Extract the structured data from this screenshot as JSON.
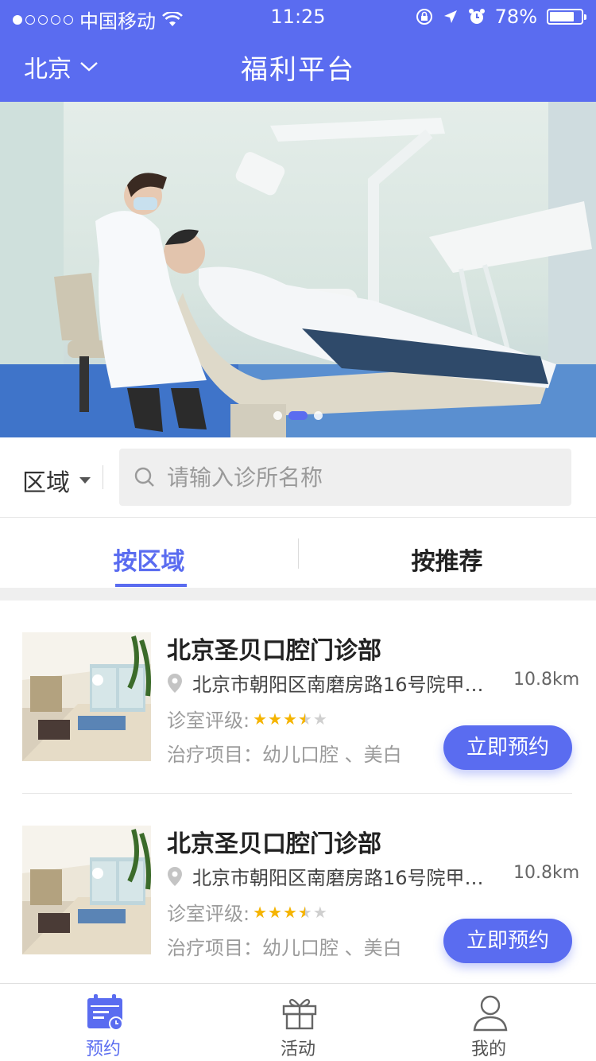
{
  "status_bar": {
    "carrier": "中国移动",
    "time": "11:25",
    "battery": "78%",
    "battery_level": 0.78
  },
  "header": {
    "city": "北京",
    "title": "福利平台"
  },
  "banner": {
    "active_slide": 2,
    "slide_count": 3
  },
  "search": {
    "region_label": "区域",
    "placeholder": "请输入诊所名称"
  },
  "tabs": [
    {
      "label": "按区域",
      "active": true
    },
    {
      "label": "按推荐",
      "active": false
    }
  ],
  "clinics": [
    {
      "name": "北京圣贝口腔门诊部",
      "address": "北京市朝阳区南磨房路16号院甲…",
      "distance": "10.8km",
      "rating_label": "诊室评级:",
      "rating": 3.5,
      "treatment": "治疗项目：幼儿口腔 、美白",
      "button": "立即预约"
    },
    {
      "name": "北京圣贝口腔门诊部",
      "address": "北京市朝阳区南磨房路16号院甲…",
      "distance": "10.8km",
      "rating_label": "诊室评级:",
      "rating": 3.5,
      "treatment": "治疗项目：幼儿口腔 、美白",
      "button": "立即预约"
    }
  ],
  "bottom_nav": [
    {
      "label": "预约",
      "icon": "calendar-icon",
      "active": true
    },
    {
      "label": "活动",
      "icon": "gift-icon",
      "active": false
    },
    {
      "label": "我的",
      "icon": "user-icon",
      "active": false
    }
  ],
  "colors": {
    "primary": "#5a6cf0",
    "star": "#f5b400",
    "text_muted": "#9b9b9b"
  }
}
